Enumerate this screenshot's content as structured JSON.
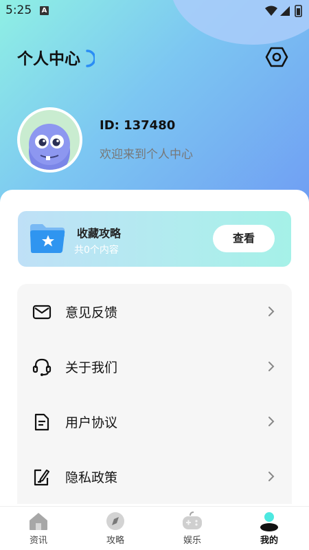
{
  "status_bar": {
    "time": "5:25",
    "notif_badge": "A"
  },
  "header": {
    "title": "个人中心"
  },
  "profile": {
    "id_text": "ID: 137480",
    "welcome": "欢迎来到个人中心"
  },
  "favorites": {
    "title": "收藏攻略",
    "count_text": "共0个内容",
    "view_label": "查看"
  },
  "menu": {
    "items": [
      {
        "label": "意见反馈",
        "icon": "mail-icon"
      },
      {
        "label": "关于我们",
        "icon": "headset-icon"
      },
      {
        "label": "用户协议",
        "icon": "document-icon"
      },
      {
        "label": "隐私政策",
        "icon": "edit-note-icon"
      }
    ]
  },
  "tabbar": {
    "tabs": [
      {
        "label": "资讯",
        "icon": "home-icon"
      },
      {
        "label": "攻略",
        "icon": "compass-icon"
      },
      {
        "label": "娱乐",
        "icon": "gamepad-icon"
      },
      {
        "label": "我的",
        "icon": "profile-icon"
      }
    ],
    "active_index": 3
  },
  "colors": {
    "gradient_start": "#8ff0e4",
    "gradient_end": "#6f9cf3",
    "accent_cyan": "#4de8e0",
    "card_bg": "#f6f6f6"
  }
}
